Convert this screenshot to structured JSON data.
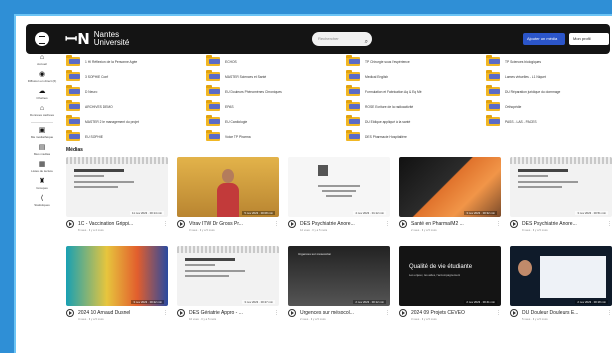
{
  "header": {
    "logo_line1": "Nantes",
    "logo_line2": "Université",
    "search_placeholder": "Rechercher",
    "add_button": "Ajouter un média",
    "user_button": "Mon profil"
  },
  "sidebar": {
    "items": [
      {
        "icon": "⌂",
        "icon_name": "home-icon",
        "label": "Accueil"
      },
      {
        "icon": "◉",
        "icon_name": "broadcast-icon",
        "label": "Diffusion en direct (6)"
      },
      {
        "icon": "☁",
        "icon_name": "channels-icon",
        "label": "Chaînes"
      },
      {
        "icon": "⌂",
        "icon_name": "lock-icon",
        "label": "Données cachées"
      },
      {
        "icon": "▣",
        "icon_name": "library-icon",
        "label": "Ma médiathèque"
      },
      {
        "icon": "▤",
        "icon_name": "mine-icon",
        "label": "Mes médias"
      },
      {
        "icon": "▦",
        "icon_name": "playlists-icon",
        "label": "Listes de lecture"
      },
      {
        "icon": "♜",
        "icon_name": "groups-icon",
        "label": "Groupes"
      },
      {
        "icon": "⟨",
        "icon_name": "stats-icon",
        "label": "Statistiques"
      }
    ]
  },
  "folders": [
    "1 HI Réflexion de la Personne Agée",
    "ECHOS",
    "TP Chirurgie sous l'espérience",
    "TP Sciences biologiques",
    "3 SOPHIE Conf",
    "MASTER Sciences et Santé",
    "Medical English",
    "Lames virtuelles - L1 Niquet",
    "D Neuro",
    "EU Douleurs Phénomènes Chroniques",
    "Formulation et Fabrication Aq & Eq Mé",
    "DU Réparation juridique du dommage",
    "ARCHIVES DEMO",
    "EPAS",
    "ROSE Ecriture de la radioactivité",
    "Orthopédie",
    "MASTER 2 le management du projet",
    "EU Cardiologie",
    "DU Eldique appliqué à la santé",
    "PASS - LAS - PACES",
    "EU SOPHIE",
    "Voice TP Pharma",
    "DES Pharmacie Hospitalière",
    ""
  ],
  "section_title": "Médias",
  "medias": [
    {
      "title": "1C - Vaccination Grippi...",
      "meta": "11 nov 2023 · 00:14 min",
      "sub": "8 vues · Il y a 4 mois",
      "look": "doc"
    },
    {
      "title": "Vtrav ITW Dr Gross Pr...",
      "meta": "5 nov 2023 · 00:08 min",
      "sub": "3 vues · Il y a 5 mois",
      "look": "person"
    },
    {
      "title": "DES Psychiatrie Anore...",
      "meta": "4 nov 2023 · 01:12 min",
      "sub": "12 vues · Il y a 5 mois",
      "look": "slide"
    },
    {
      "title": "Santé en Pharma/M2 ...",
      "meta": "3 nov 2023 · 00:32 min",
      "sub": "2 vues · Il y a 5 mois",
      "look": "lab"
    },
    {
      "title": "DES Psychiatrie Anore...",
      "meta": "3 nov 2023 · 00:51 min",
      "sub": "9 vues · Il y a 5 mois",
      "look": "doc"
    },
    {
      "title": "2024 10 Arnaud Dusnel",
      "meta": "3 nov 2023 · 00:22 min",
      "sub": "4 vues · Il y a 5 mois",
      "look": "brain"
    },
    {
      "title": "DES Gériatrie Appro - ...",
      "meta": "3 nov 2023 · 00:27 min",
      "sub": "16 vues · Il y a 5 mois",
      "look": "doc"
    },
    {
      "title": "Urgences sur mésocol...",
      "meta": "2 nov 2023 · 00:12 min",
      "sub": "2 vues · Il y a 5 mois",
      "look": "dark",
      "overlay": "Urgences sur mésocolon"
    },
    {
      "title": "2024 09 Projets CEVEO",
      "meta": "2 nov 2023 · 00:41 min",
      "sub": "3 vues · Il y a 5 mois",
      "look": "night",
      "overlay": "Qualité de vie étudiante",
      "overlay_sub": "Les enjeux, les aides, l'accompagnement"
    },
    {
      "title": "DU Douleur Douleurs E...",
      "meta": "2 nov 2023 · 00:18 min",
      "sub": "5 vues · Il y a 5 mois",
      "look": "video"
    }
  ]
}
